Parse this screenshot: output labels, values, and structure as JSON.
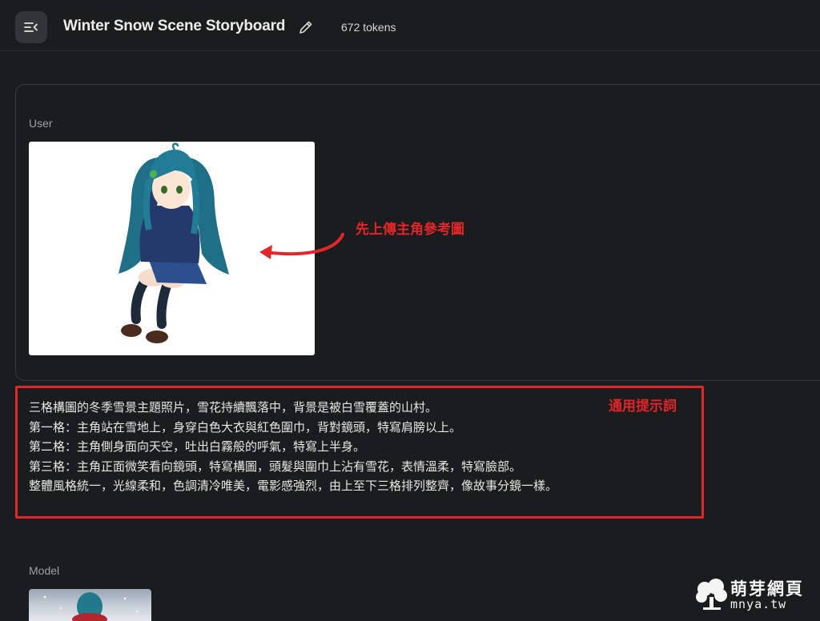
{
  "header": {
    "menu_icon": "collapse-menu-icon",
    "title": "Winter Snow Scene Storyboard",
    "edit_icon": "pencil-icon",
    "tokens": "672 tokens"
  },
  "user_turn": {
    "role": "User",
    "image_alt": "anime girl reference image",
    "annotation": "先上傳主角參考圖"
  },
  "prompt": {
    "annotation": "通用提示詞",
    "lines": [
      "三格構圖的冬季雪景主題照片，雪花持續飄落中，背景是被白雪覆蓋的山村。",
      "第一格：主角站在雪地上，身穿白色大衣與紅色圍巾，背對鏡頭，特寫肩膀以上。",
      "第二格：主角側身面向天空，吐出白霧般的呼氣，特寫上半身。",
      "第三格：主角正面微笑看向鏡頭，特寫構圖，頭髮與圍巾上沾有雪花，表情溫柔，特寫臉部。",
      "整體風格統一，光線柔和，色調清冷唯美，電影感強烈，由上至下三格排列整齊，像故事分鏡一樣。"
    ]
  },
  "model_turn": {
    "role": "Model"
  },
  "watermark": {
    "name": "萌芽網頁",
    "domain": "mnya.tw"
  },
  "colors": {
    "background": "#1b1c1d",
    "annotation_red": "#e3262a",
    "muted_text": "#9aa0a6"
  }
}
